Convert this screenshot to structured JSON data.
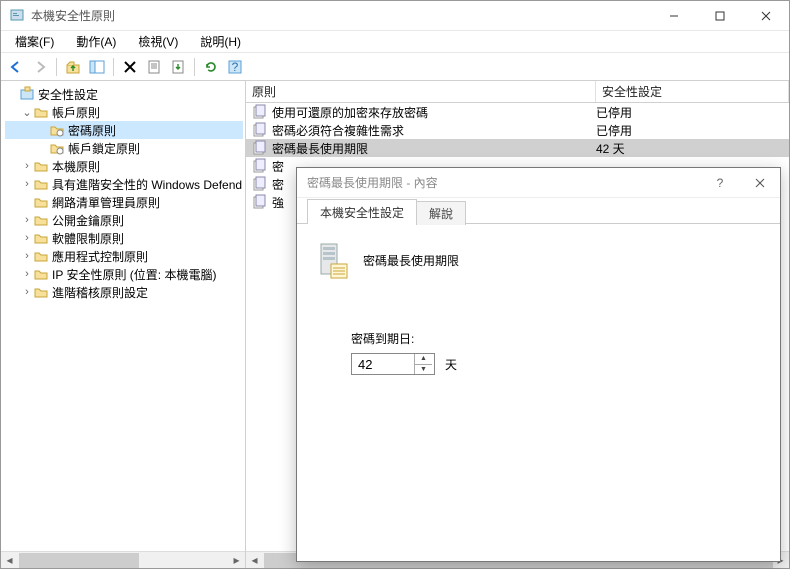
{
  "window": {
    "title": "本機安全性原則"
  },
  "menu": {
    "file": "檔案(F)",
    "action": "動作(A)",
    "view": "檢視(V)",
    "help": "說明(H)"
  },
  "tree": {
    "root": "安全性設定",
    "items": [
      {
        "label": "帳戶原則",
        "expanded": true
      },
      {
        "label": "密碼原則",
        "selected": true
      },
      {
        "label": "帳戶鎖定原則"
      },
      {
        "label": "本機原則"
      },
      {
        "label": "具有進階安全性的 Windows Defend"
      },
      {
        "label": "網路清單管理員原則"
      },
      {
        "label": "公開金鑰原則"
      },
      {
        "label": "軟體限制原則"
      },
      {
        "label": "應用程式控制原則"
      },
      {
        "label": "IP 安全性原則 (位置: 本機電腦)"
      },
      {
        "label": "進階稽核原則設定"
      }
    ]
  },
  "list": {
    "col1": "原則",
    "col2": "安全性設定",
    "rows": [
      {
        "policy": "使用可還原的加密來存放密碼",
        "setting": "已停用"
      },
      {
        "policy": "密碼必須符合複雜性需求",
        "setting": "已停用"
      },
      {
        "policy": "密碼最長使用期限",
        "setting": "42 天",
        "selected": true
      },
      {
        "policy": "密",
        "setting": ""
      },
      {
        "policy": "密",
        "setting": ""
      },
      {
        "policy": "強",
        "setting": ""
      }
    ]
  },
  "dialog": {
    "title": "密碼最長使用期限 - 內容",
    "tab1": "本機安全性設定",
    "tab2": "解說",
    "heading": "密碼最長使用期限",
    "field_label": "密碼到期日:",
    "value": "42",
    "unit": "天"
  }
}
